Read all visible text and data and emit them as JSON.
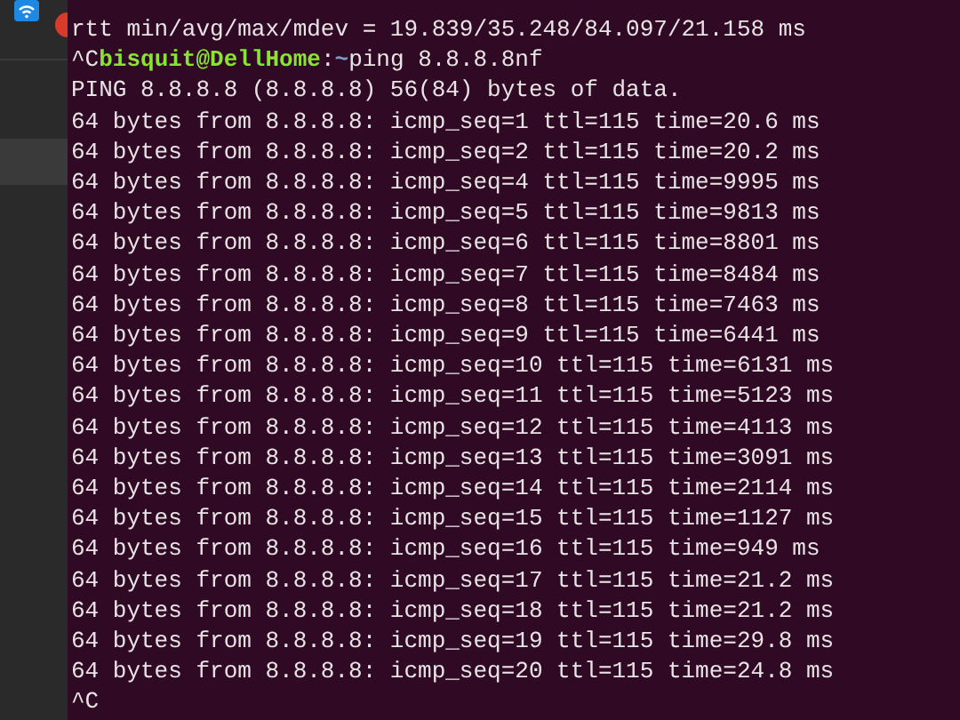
{
  "terminal": {
    "lines": [
      {
        "kind": "output",
        "text": "rtt min/avg/max/mdev = 19.839/35.248/84.097/21.158 ms"
      },
      {
        "kind": "prompt",
        "prefix": "^C",
        "user_host": "bisquit@DellHome",
        "separator": ":",
        "path": "~",
        "command": "ping 8.8.8.8nf"
      },
      {
        "kind": "output",
        "text": "PING 8.8.8.8 (8.8.8.8) 56(84) bytes of data."
      },
      {
        "kind": "output",
        "text": "64 bytes from 8.8.8.8: icmp_seq=1 ttl=115 time=20.6 ms"
      },
      {
        "kind": "output",
        "text": "64 bytes from 8.8.8.8: icmp_seq=2 ttl=115 time=20.2 ms"
      },
      {
        "kind": "output",
        "text": "64 bytes from 8.8.8.8: icmp_seq=4 ttl=115 time=9995 ms"
      },
      {
        "kind": "output",
        "text": "64 bytes from 8.8.8.8: icmp_seq=5 ttl=115 time=9813 ms"
      },
      {
        "kind": "output",
        "text": "64 bytes from 8.8.8.8: icmp_seq=6 ttl=115 time=8801 ms"
      },
      {
        "kind": "output",
        "text": "64 bytes from 8.8.8.8: icmp_seq=7 ttl=115 time=8484 ms"
      },
      {
        "kind": "output",
        "text": "64 bytes from 8.8.8.8: icmp_seq=8 ttl=115 time=7463 ms"
      },
      {
        "kind": "output",
        "text": "64 bytes from 8.8.8.8: icmp_seq=9 ttl=115 time=6441 ms"
      },
      {
        "kind": "output",
        "text": "64 bytes from 8.8.8.8: icmp_seq=10 ttl=115 time=6131 ms"
      },
      {
        "kind": "output",
        "text": "64 bytes from 8.8.8.8: icmp_seq=11 ttl=115 time=5123 ms"
      },
      {
        "kind": "output",
        "text": "64 bytes from 8.8.8.8: icmp_seq=12 ttl=115 time=4113 ms"
      },
      {
        "kind": "output",
        "text": "64 bytes from 8.8.8.8: icmp_seq=13 ttl=115 time=3091 ms"
      },
      {
        "kind": "output",
        "text": "64 bytes from 8.8.8.8: icmp_seq=14 ttl=115 time=2114 ms"
      },
      {
        "kind": "output",
        "text": "64 bytes from 8.8.8.8: icmp_seq=15 ttl=115 time=1127 ms"
      },
      {
        "kind": "output",
        "text": "64 bytes from 8.8.8.8: icmp_seq=16 ttl=115 time=949 ms"
      },
      {
        "kind": "output",
        "text": "64 bytes from 8.8.8.8: icmp_seq=17 ttl=115 time=21.2 ms"
      },
      {
        "kind": "output",
        "text": "64 bytes from 8.8.8.8: icmp_seq=18 ttl=115 time=21.2 ms"
      },
      {
        "kind": "output",
        "text": "64 bytes from 8.8.8.8: icmp_seq=19 ttl=115 time=29.8 ms"
      },
      {
        "kind": "output",
        "text": "64 bytes from 8.8.8.8: icmp_seq=20 ttl=115 time=24.8 ms"
      },
      {
        "kind": "output",
        "text": "^C"
      }
    ]
  }
}
